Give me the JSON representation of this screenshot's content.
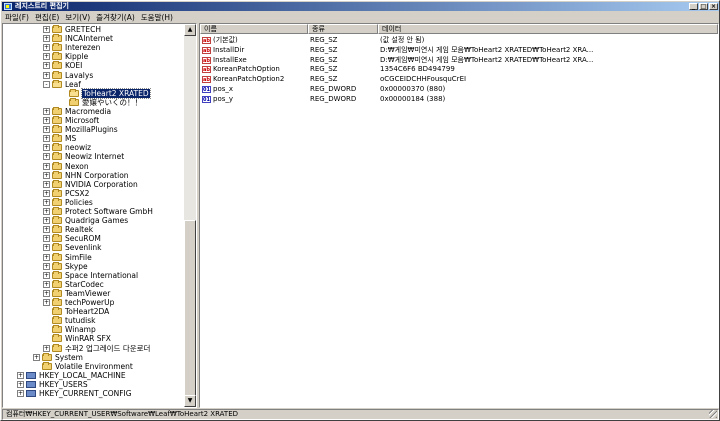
{
  "window": {
    "title": "레지스트리 편집기"
  },
  "menu": [
    "파일(F)",
    "편집(E)",
    "보기(V)",
    "즐겨찾기(A)",
    "도움말(H)"
  ],
  "tree": {
    "nodes": [
      {
        "label": "GRETECH",
        "expander": "+"
      },
      {
        "label": "INCAInternet",
        "expander": "+"
      },
      {
        "label": "Interezen",
        "expander": "+"
      },
      {
        "label": "Kipple",
        "expander": "+"
      },
      {
        "label": "KOEI",
        "expander": "+"
      },
      {
        "label": "Lavalys",
        "expander": "+"
      },
      {
        "label": "Leaf",
        "expander": "-"
      },
      {
        "label": "ToHeart2 XRATED",
        "expander": "",
        "selected": true
      },
      {
        "label": "愛嬢やいくの！！",
        "expander": ""
      },
      {
        "label": "Macromedia",
        "expander": "+"
      },
      {
        "label": "Microsoft",
        "expander": "+"
      },
      {
        "label": "MozillaPlugins",
        "expander": "+"
      },
      {
        "label": "MS",
        "expander": "+"
      },
      {
        "label": "neowiz",
        "expander": "+"
      },
      {
        "label": "Neowiz Internet",
        "expander": "+"
      },
      {
        "label": "Nexon",
        "expander": "+"
      },
      {
        "label": "NHN Corporation",
        "expander": "+"
      },
      {
        "label": "NVIDIA Corporation",
        "expander": "+"
      },
      {
        "label": "PCSX2",
        "expander": "+"
      },
      {
        "label": "Policies",
        "expander": "+"
      },
      {
        "label": "Protect Software GmbH",
        "expander": "+"
      },
      {
        "label": "Quadriga Games",
        "expander": "+"
      },
      {
        "label": "Realtek",
        "expander": "+"
      },
      {
        "label": "SecuROM",
        "expander": "+"
      },
      {
        "label": "Sevenlink",
        "expander": "+"
      },
      {
        "label": "SimFile",
        "expander": "+"
      },
      {
        "label": "Skype",
        "expander": "+"
      },
      {
        "label": "Space International",
        "expander": "+"
      },
      {
        "label": "StarCodec",
        "expander": "+"
      },
      {
        "label": "TeamViewer",
        "expander": "+"
      },
      {
        "label": "techPowerUp",
        "expander": "+"
      },
      {
        "label": "ToHeart2DA",
        "expander": ""
      },
      {
        "label": "tutudisk",
        "expander": ""
      },
      {
        "label": "Winamp",
        "expander": ""
      },
      {
        "label": "WinRAR SFX",
        "expander": ""
      },
      {
        "label": "수퍼2 업그레이드 다운로더",
        "expander": "+"
      },
      {
        "label": "System",
        "expander": "+"
      },
      {
        "label": "Volatile Environment",
        "expander": ""
      },
      {
        "label": "HKEY_LOCAL_MACHINE",
        "expander": "+"
      },
      {
        "label": "HKEY_USERS",
        "expander": "+"
      },
      {
        "label": "HKEY_CURRENT_CONFIG",
        "expander": "+"
      }
    ]
  },
  "list": {
    "headers": {
      "name": "이름",
      "type": "종류",
      "data": "데이터"
    },
    "rows": [
      {
        "icon": "ab",
        "name": "(기본값)",
        "type": "REG_SZ",
        "data": "(값 설정 안 됨)"
      },
      {
        "icon": "ab",
        "name": "InstallDir",
        "type": "REG_SZ",
        "data": "D:₩게임₩미연시 게임 모음₩ToHeart2 XRATED₩ToHeart2 XRA..."
      },
      {
        "icon": "ab",
        "name": "InstallExe",
        "type": "REG_SZ",
        "data": "D:₩게임₩미연시 게임 모음₩ToHeart2 XRATED₩ToHeart2 XRA..."
      },
      {
        "icon": "ab",
        "name": "KoreanPatchOption",
        "type": "REG_SZ",
        "data": "1354C6F6 BD494799"
      },
      {
        "icon": "ab",
        "name": "KoreanPatchOption2",
        "type": "REG_SZ",
        "data": "oCGCEIDCHHFousquCrEI"
      },
      {
        "icon": "01",
        "name": "pos_x",
        "type": "REG_DWORD",
        "data": "0x00000370 (880)"
      },
      {
        "icon": "01",
        "name": "pos_y",
        "type": "REG_DWORD",
        "data": "0x00000184 (388)"
      }
    ]
  },
  "status": {
    "path": "컴퓨터₩HKEY_CURRENT_USER₩Software₩Leaf₩ToHeart2 XRATED"
  }
}
